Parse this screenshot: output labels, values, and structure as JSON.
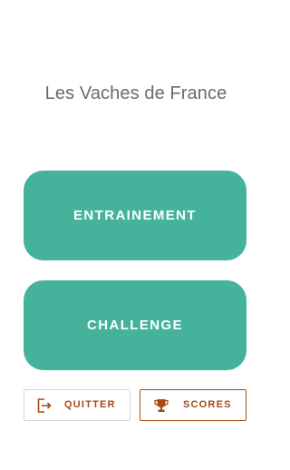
{
  "header": {
    "title": "Les Vaches de France"
  },
  "main": {
    "entrainement_label": "ENTRAINEMENT",
    "challenge_label": "CHALLENGE"
  },
  "footer": {
    "quitter_label": "QUITTER",
    "quitter_icon": "exit-icon",
    "scores_label": "SCORES",
    "scores_icon": "trophy-icon"
  },
  "colors": {
    "primary_button": "#45b39c",
    "accent": "#a84a12",
    "title_text": "#6b6b6b"
  }
}
